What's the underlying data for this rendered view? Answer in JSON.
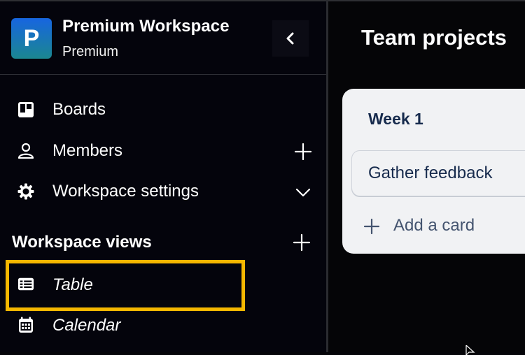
{
  "workspace": {
    "logo_letter": "P",
    "name": "Premium Workspace",
    "plan": "Premium",
    "collapse_icon": "chevron-left-icon"
  },
  "sidebar": {
    "items": [
      {
        "label": "Boards",
        "icon": "board-icon",
        "action": null
      },
      {
        "label": "Members",
        "icon": "person-icon",
        "action": "plus-icon"
      },
      {
        "label": "Workspace settings",
        "icon": "gear-icon",
        "action": "chevron-down-icon"
      }
    ],
    "views_section": {
      "title": "Workspace views",
      "add_icon": "plus-icon",
      "items": [
        {
          "label": "Table",
          "icon": "table-icon",
          "highlighted": true
        },
        {
          "label": "Calendar",
          "icon": "calendar-icon",
          "highlighted": false
        }
      ]
    }
  },
  "board": {
    "title": "Team projects",
    "lists": [
      {
        "title": "Week 1",
        "cards": [
          {
            "title": "Gather feedback"
          }
        ],
        "add_card_label": "Add a card"
      }
    ]
  },
  "colors": {
    "highlight": "#f5b700",
    "list_bg": "#f1f2f4",
    "list_text": "#172b4d",
    "logo_gradient_top": "#1765e0",
    "logo_gradient_bottom": "#1b8790"
  }
}
